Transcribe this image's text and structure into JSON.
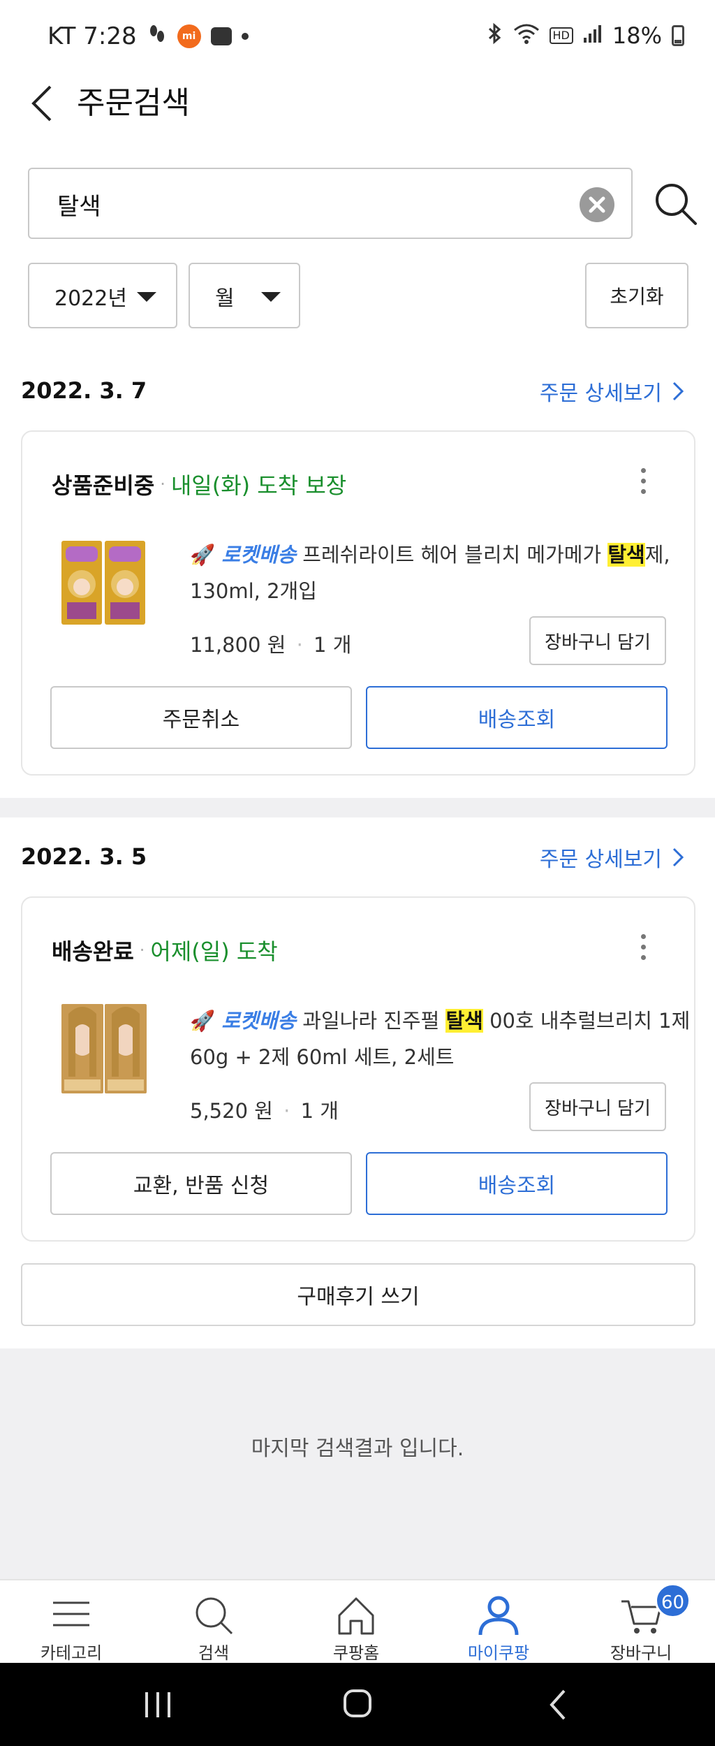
{
  "status_bar": {
    "carrier_time": "KT 7:28",
    "mi_badge": "mi",
    "battery": "18%",
    "hd_label": "HD",
    "icons": [
      "footsteps-icon",
      "mi-app-icon",
      "chat-icon",
      "notification-dot-icon",
      "bluetooth-icon",
      "wifi-icon",
      "hd-voice-icon",
      "signal-icon",
      "battery-icon"
    ]
  },
  "header": {
    "title": "주문검색"
  },
  "search": {
    "value": "탈색",
    "placeholder": ""
  },
  "filters": {
    "year": "2022년",
    "month": "월",
    "reset_label": "초기화"
  },
  "orders": [
    {
      "date": "2022. 3. 7",
      "detail_link": "주문 상세보기",
      "status": "상품준비중",
      "arrival": "내일(화) 도착 보장",
      "rocket_label": "로켓배송",
      "title_before": "프레쉬라이트 헤어 블리치 메가메가 ",
      "title_highlight": "탈색",
      "title_after": "제, 130ml, 2개입",
      "price": "11,800 원",
      "quantity": "1 개",
      "cart_add_label": "장바구니 담기",
      "left_button": "주문취소",
      "right_button": "배송조회"
    },
    {
      "date": "2022. 3. 5",
      "detail_link": "주문 상세보기",
      "status": "배송완료",
      "arrival": "어제(일) 도착",
      "rocket_label": "로켓배송",
      "title_before": "과일나라 진주펄 ",
      "title_highlight": "탈색",
      "title_after": " 00호 내추럴브리치 1제 60g + 2제 60ml 세트, 2세트",
      "price": "5,520 원",
      "quantity": "1 개",
      "cart_add_label": "장바구니 담기",
      "left_button": "교환, 반품 신청",
      "right_button": "배송조회",
      "review_button": "구매후기 쓰기"
    }
  ],
  "end_message": "마지막 검색결과 입니다.",
  "bottom_nav": {
    "items": [
      {
        "label": "카테고리",
        "icon": "menu-icon"
      },
      {
        "label": "검색",
        "icon": "search-icon"
      },
      {
        "label": "쿠팡홈",
        "icon": "home-icon"
      },
      {
        "label": "마이쿠팡",
        "icon": "user-icon",
        "active": true
      },
      {
        "label": "장바구니",
        "icon": "cart-icon"
      }
    ],
    "cart_count": "60",
    "active_color": "#2d6ed6"
  },
  "colors": {
    "accent": "#2d6ed6",
    "arrival_green": "#1a8f2d",
    "highlight": "#ffef33",
    "rocket": "#3a7ee5"
  }
}
